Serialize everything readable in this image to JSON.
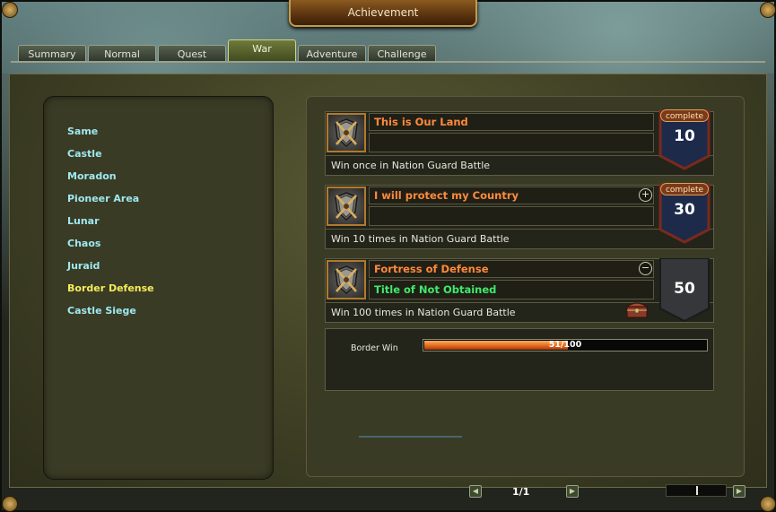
{
  "window": {
    "title": "Achievement"
  },
  "tabs": [
    {
      "label": "Summary",
      "active": false
    },
    {
      "label": "Normal",
      "active": false
    },
    {
      "label": "Quest",
      "active": false
    },
    {
      "label": "War",
      "active": true
    },
    {
      "label": "Adventure",
      "active": false
    },
    {
      "label": "Challenge",
      "active": false
    }
  ],
  "categories": [
    {
      "label": "Same",
      "active": false
    },
    {
      "label": "Castle",
      "active": false
    },
    {
      "label": "Moradon",
      "active": false
    },
    {
      "label": "Pioneer Area",
      "active": false
    },
    {
      "label": "Lunar",
      "active": false
    },
    {
      "label": "Chaos",
      "active": false
    },
    {
      "label": "Juraid",
      "active": false
    },
    {
      "label": "Border Defense",
      "active": true
    },
    {
      "label": "Castle Siege",
      "active": false
    }
  ],
  "achievements": [
    {
      "title": "This is Our Land",
      "subtitle": "",
      "description": "Win once in Nation Guard Battle",
      "badge_label": "complete",
      "points": "10",
      "toggle": "",
      "completed": true,
      "icon": "shield-crossed-swords-icon"
    },
    {
      "title": "I will protect my Country",
      "subtitle": "",
      "description": "Win 10 times in Nation Guard Battle",
      "badge_label": "complete",
      "points": "30",
      "toggle": "+",
      "completed": true,
      "icon": "shield-crossed-swords-icon"
    },
    {
      "title": "Fortress of Defense",
      "subtitle": "Title of Not Obtained",
      "description": "Win 100 times in Nation Guard Battle",
      "badge_label": "",
      "points": "50",
      "toggle": "−",
      "completed": false,
      "icon": "shield-crossed-swords-icon",
      "reward_icon": "treasure-chest-icon"
    }
  ],
  "progress": {
    "label": "Border Win",
    "text": "51/100",
    "fraction": 0.51
  },
  "pager": {
    "text": "1/1"
  },
  "colors": {
    "category_text": "#9fe8f0",
    "category_active": "#f5ec5a",
    "achievement_title": "#ff8a3a",
    "achievement_subtitle": "#3fea6a",
    "badge_complete_bg": "#1d2a4a",
    "badge_incomplete_bg": "#35373a",
    "progress_fill": "#e0641c"
  }
}
